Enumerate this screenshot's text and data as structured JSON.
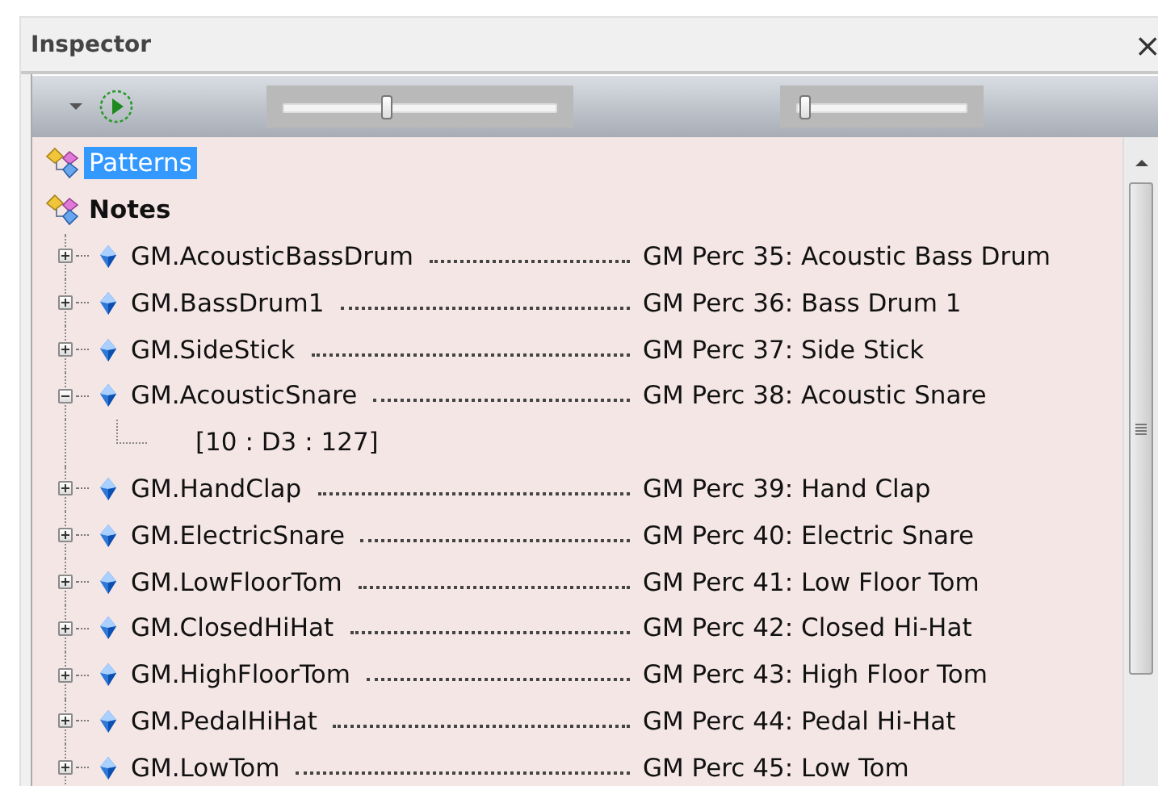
{
  "window": {
    "title": "Inspector",
    "close": "×"
  },
  "toolbar": {
    "sliders": [
      {
        "level": 0.38
      },
      {
        "level": 0.05
      }
    ]
  },
  "tree": [
    {
      "label": "Patterns",
      "selected": true,
      "bold": false
    },
    {
      "label": "Notes",
      "selected": false,
      "bold": true,
      "children": [
        {
          "name": "GM.AcousticBassDrum",
          "description": "GM Perc 35: Acoustic Bass Drum",
          "expanded": false
        },
        {
          "name": "GM.BassDrum1",
          "description": "GM Perc 36: Bass Drum 1",
          "expanded": false
        },
        {
          "name": "GM.SideStick",
          "description": "GM Perc 37: Side Stick",
          "expanded": false
        },
        {
          "name": "GM.AcousticSnare",
          "description": "GM Perc 38: Acoustic Snare",
          "expanded": true,
          "children": [
            {
              "label": "[10 : D3 : 127]"
            }
          ]
        },
        {
          "name": "GM.HandClap",
          "description": "GM Perc 39: Hand Clap",
          "expanded": false
        },
        {
          "name": "GM.ElectricSnare",
          "description": "GM Perc 40: Electric Snare",
          "expanded": false
        },
        {
          "name": "GM.LowFloorTom",
          "description": "GM Perc 41: Low Floor Tom",
          "expanded": false
        },
        {
          "name": "GM.ClosedHiHat",
          "description": "GM Perc 42: Closed Hi-Hat",
          "expanded": false
        },
        {
          "name": "GM.HighFloorTom",
          "description": "GM Perc 43: High Floor Tom",
          "expanded": false
        },
        {
          "name": "GM.PedalHiHat",
          "description": "GM Perc 44: Pedal Hi-Hat",
          "expanded": false
        },
        {
          "name": "GM.LowTom",
          "description": "GM Perc 45: Low Tom",
          "expanded": false
        }
      ]
    }
  ]
}
